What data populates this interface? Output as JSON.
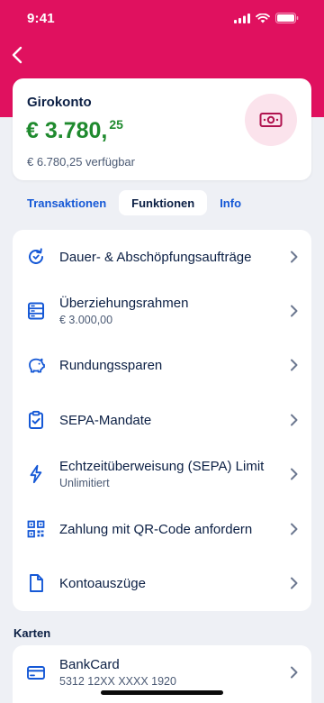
{
  "status_bar": {
    "time": "9:41"
  },
  "colors": {
    "brand": "#e0115f",
    "balance": "#1f8a2e",
    "link": "#1558d6",
    "text": "#0b1f44"
  },
  "account": {
    "name": "Girokonto",
    "balance_main": "€ 3.780,",
    "balance_cents": "25",
    "available": "€ 6.780,25 verfügbar",
    "icon": "banknote-icon"
  },
  "tabs": [
    {
      "label": "Transaktionen",
      "active": false
    },
    {
      "label": "Funktionen",
      "active": true
    },
    {
      "label": "Info",
      "active": false
    }
  ],
  "functions": [
    {
      "title": "Dauer- & Abschöpfungsaufträge",
      "sub": "",
      "icon": "recurring-icon"
    },
    {
      "title": "Überziehungsrahmen",
      "sub": "€ 3.000,00",
      "icon": "server-stack-icon"
    },
    {
      "title": "Rundungssparen",
      "sub": "",
      "icon": "piggy-bank-icon"
    },
    {
      "title": "SEPA-Mandate",
      "sub": "",
      "icon": "clipboard-check-icon"
    },
    {
      "title": "Echtzeitüberweisung (SEPA) Limit",
      "sub": "Unlimitiert",
      "icon": "lightning-icon"
    },
    {
      "title": "Zahlung mit QR-Code anfordern",
      "sub": "",
      "icon": "qr-code-icon"
    },
    {
      "title": "Kontoauszüge",
      "sub": "",
      "icon": "document-icon"
    }
  ],
  "cards_section": {
    "title": "Karten",
    "items": [
      {
        "title": "BankCard",
        "sub": "5312 12XX XXXX 1920",
        "icon": "credit-card-icon"
      }
    ]
  }
}
